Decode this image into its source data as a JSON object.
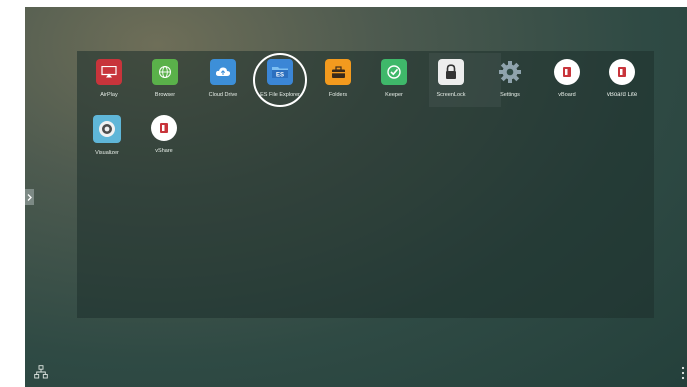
{
  "apps": [
    {
      "label": "AirPlay",
      "icon": "airplay-icon",
      "color": "#c8343b"
    },
    {
      "label": "Browser",
      "icon": "globe-icon",
      "color": "#5ab14a"
    },
    {
      "label": "Cloud Drive",
      "icon": "cloud-upload-icon",
      "color": "#3d8fd8"
    },
    {
      "label": "ES File Explorer",
      "icon": "es-folder-icon",
      "color": "#3b86d6"
    },
    {
      "label": "Folders",
      "icon": "briefcase-icon",
      "color": "#f39a1e"
    },
    {
      "label": "Keeper",
      "icon": "keeper-check-icon",
      "color": "#3fb86a"
    },
    {
      "label": "ScreenLock",
      "icon": "padlock-icon",
      "color": "#ededed"
    },
    {
      "label": "Settings",
      "icon": "gear-icon",
      "color": "#8fa3ad"
    },
    {
      "label": "vBoard",
      "icon": "vboard-icon",
      "color": "#ffffff"
    },
    {
      "label": "vBoard Lite",
      "icon": "vboard-lite-icon",
      "color": "#ffffff"
    },
    {
      "label": "Visualizer",
      "icon": "camera-lens-icon",
      "color": "#5fb6d8"
    },
    {
      "label": "vShare",
      "icon": "vshare-icon",
      "color": "#ffffff"
    }
  ],
  "selected_app": "ES File Explorer",
  "system": {
    "side_tab_icon": "chevron-right-icon",
    "network_icon": "network-icon",
    "menu_icon": "more-vertical-icon"
  }
}
